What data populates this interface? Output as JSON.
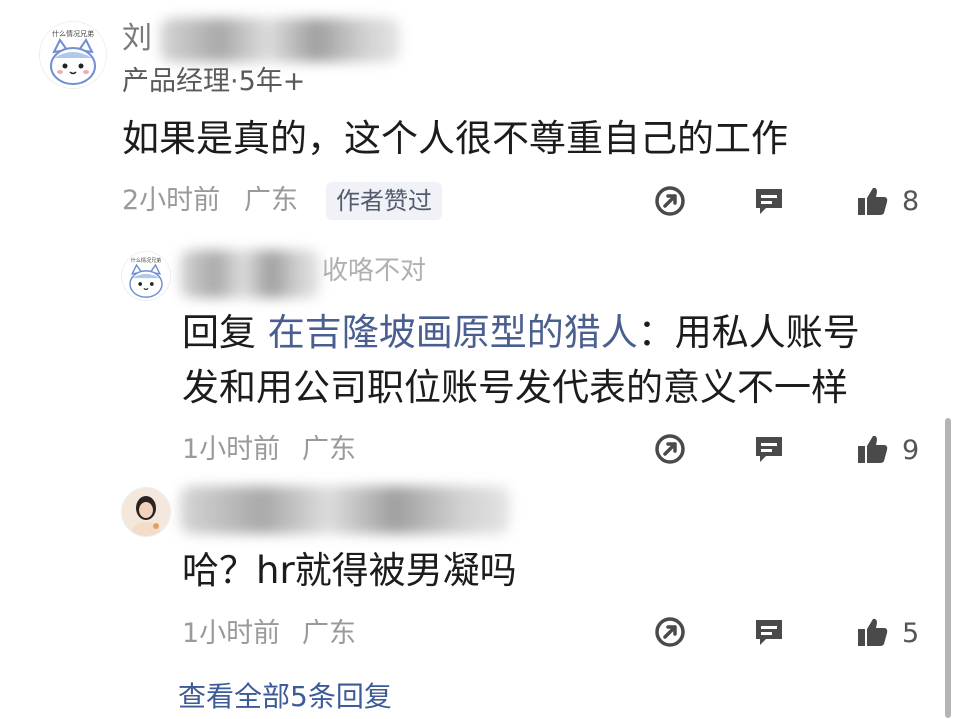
{
  "comments": [
    {
      "name_visible": "刘",
      "avatar_caption": "什么情况兄弟",
      "title": "产品经理·5年+",
      "text": "如果是真的，这个人很不尊重自己的工作",
      "time": "2小时前",
      "location": "广东",
      "badge": "作者赞过",
      "likes": "8"
    },
    {
      "avatar_caption": "什么情况兄弟",
      "name_visible": "收咯不对",
      "reply_prefix": "回复",
      "reply_to": "在吉隆坡画原型的猎人",
      "reply_colon": "：",
      "text_line1": "用私人账号",
      "text_line2": "发和用公司职位账号发代表的意义不一样",
      "time": "1小时前",
      "location": "广东",
      "likes": "9"
    },
    {
      "text": "哈？hr就得被男凝吗",
      "time": "1小时前",
      "location": "广东",
      "likes": "5"
    }
  ],
  "view_all": "查看全部5条回复",
  "icons": {
    "share": "share-icon",
    "comment": "comment-icon",
    "like": "thumbs-up-icon"
  },
  "colors": {
    "link": "#3d5a99",
    "reply_target": "#4a5f8f",
    "icon": "#4a4a4a"
  }
}
